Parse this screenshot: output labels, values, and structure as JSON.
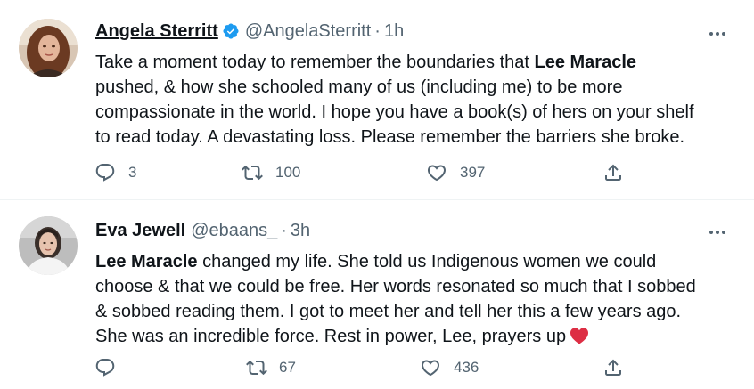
{
  "tweets": [
    {
      "name": "Angela Sterritt",
      "verified": true,
      "handle": "@AngelaSterritt",
      "separator": "·",
      "time": "1h",
      "text": {
        "part1": "Take a moment today to remember the boundaries that ",
        "bold1": "Lee Maracle",
        "part2": " pushed, & how she schooled many of us (including me) to be more compassionate in the world. I hope you have a book(s) of hers on your shelf to read today. A devastating loss. Please remember the barriers she broke."
      },
      "replies": "3",
      "retweets": "100",
      "likes": "397"
    },
    {
      "name": "Eva Jewell",
      "verified": false,
      "handle": "@ebaans_",
      "separator": "·",
      "time": "3h",
      "text": {
        "bold1": "Lee Maracle",
        "part1": " changed my life. She told us Indigenous women we could choose & that we could be free. Her words resonated so much that I sobbed & sobbed reading them. I got to meet her and tell her this a few years ago. She was an incredible force. Rest in power, Lee, prayers up"
      },
      "emoji": "red-heart",
      "replies": "",
      "retweets": "67",
      "likes": "436"
    }
  ],
  "icons": {
    "reply": "reply-icon",
    "retweet": "retweet-icon",
    "like": "like-icon",
    "share": "share-icon",
    "more": "more-options-icon",
    "verified": "verified-badge-icon"
  },
  "colors": {
    "text": "#0f1419",
    "secondary": "#536471",
    "verified": "#1d9bf0",
    "heart": "#e0245e"
  }
}
